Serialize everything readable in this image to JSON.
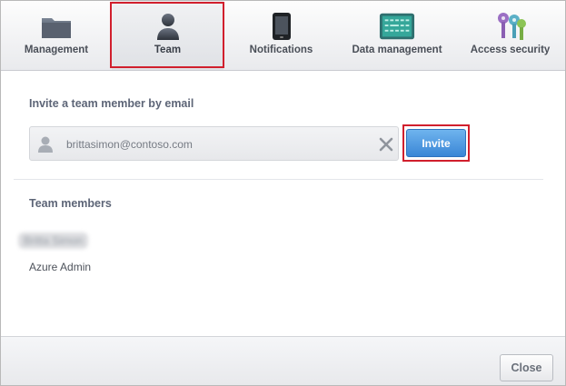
{
  "tabs": [
    {
      "label": "Management",
      "icon": "folder-icon"
    },
    {
      "label": "Team",
      "icon": "person-icon",
      "active": true
    },
    {
      "label": "Notifications",
      "icon": "phone-icon"
    },
    {
      "label": "Data management",
      "icon": "terminal-icon"
    },
    {
      "label": "Access security",
      "icon": "keys-icon"
    }
  ],
  "invite": {
    "title": "Invite a team member by email",
    "email_value": "brittasimon@contoso.com",
    "button_label": "Invite"
  },
  "members": {
    "title": "Team members",
    "items": [
      "Britta Simon",
      "Azure Admin"
    ]
  },
  "footer": {
    "close_label": "Close"
  },
  "colors": {
    "highlight": "#d11f2d",
    "invite_button": "#4a95e0"
  }
}
